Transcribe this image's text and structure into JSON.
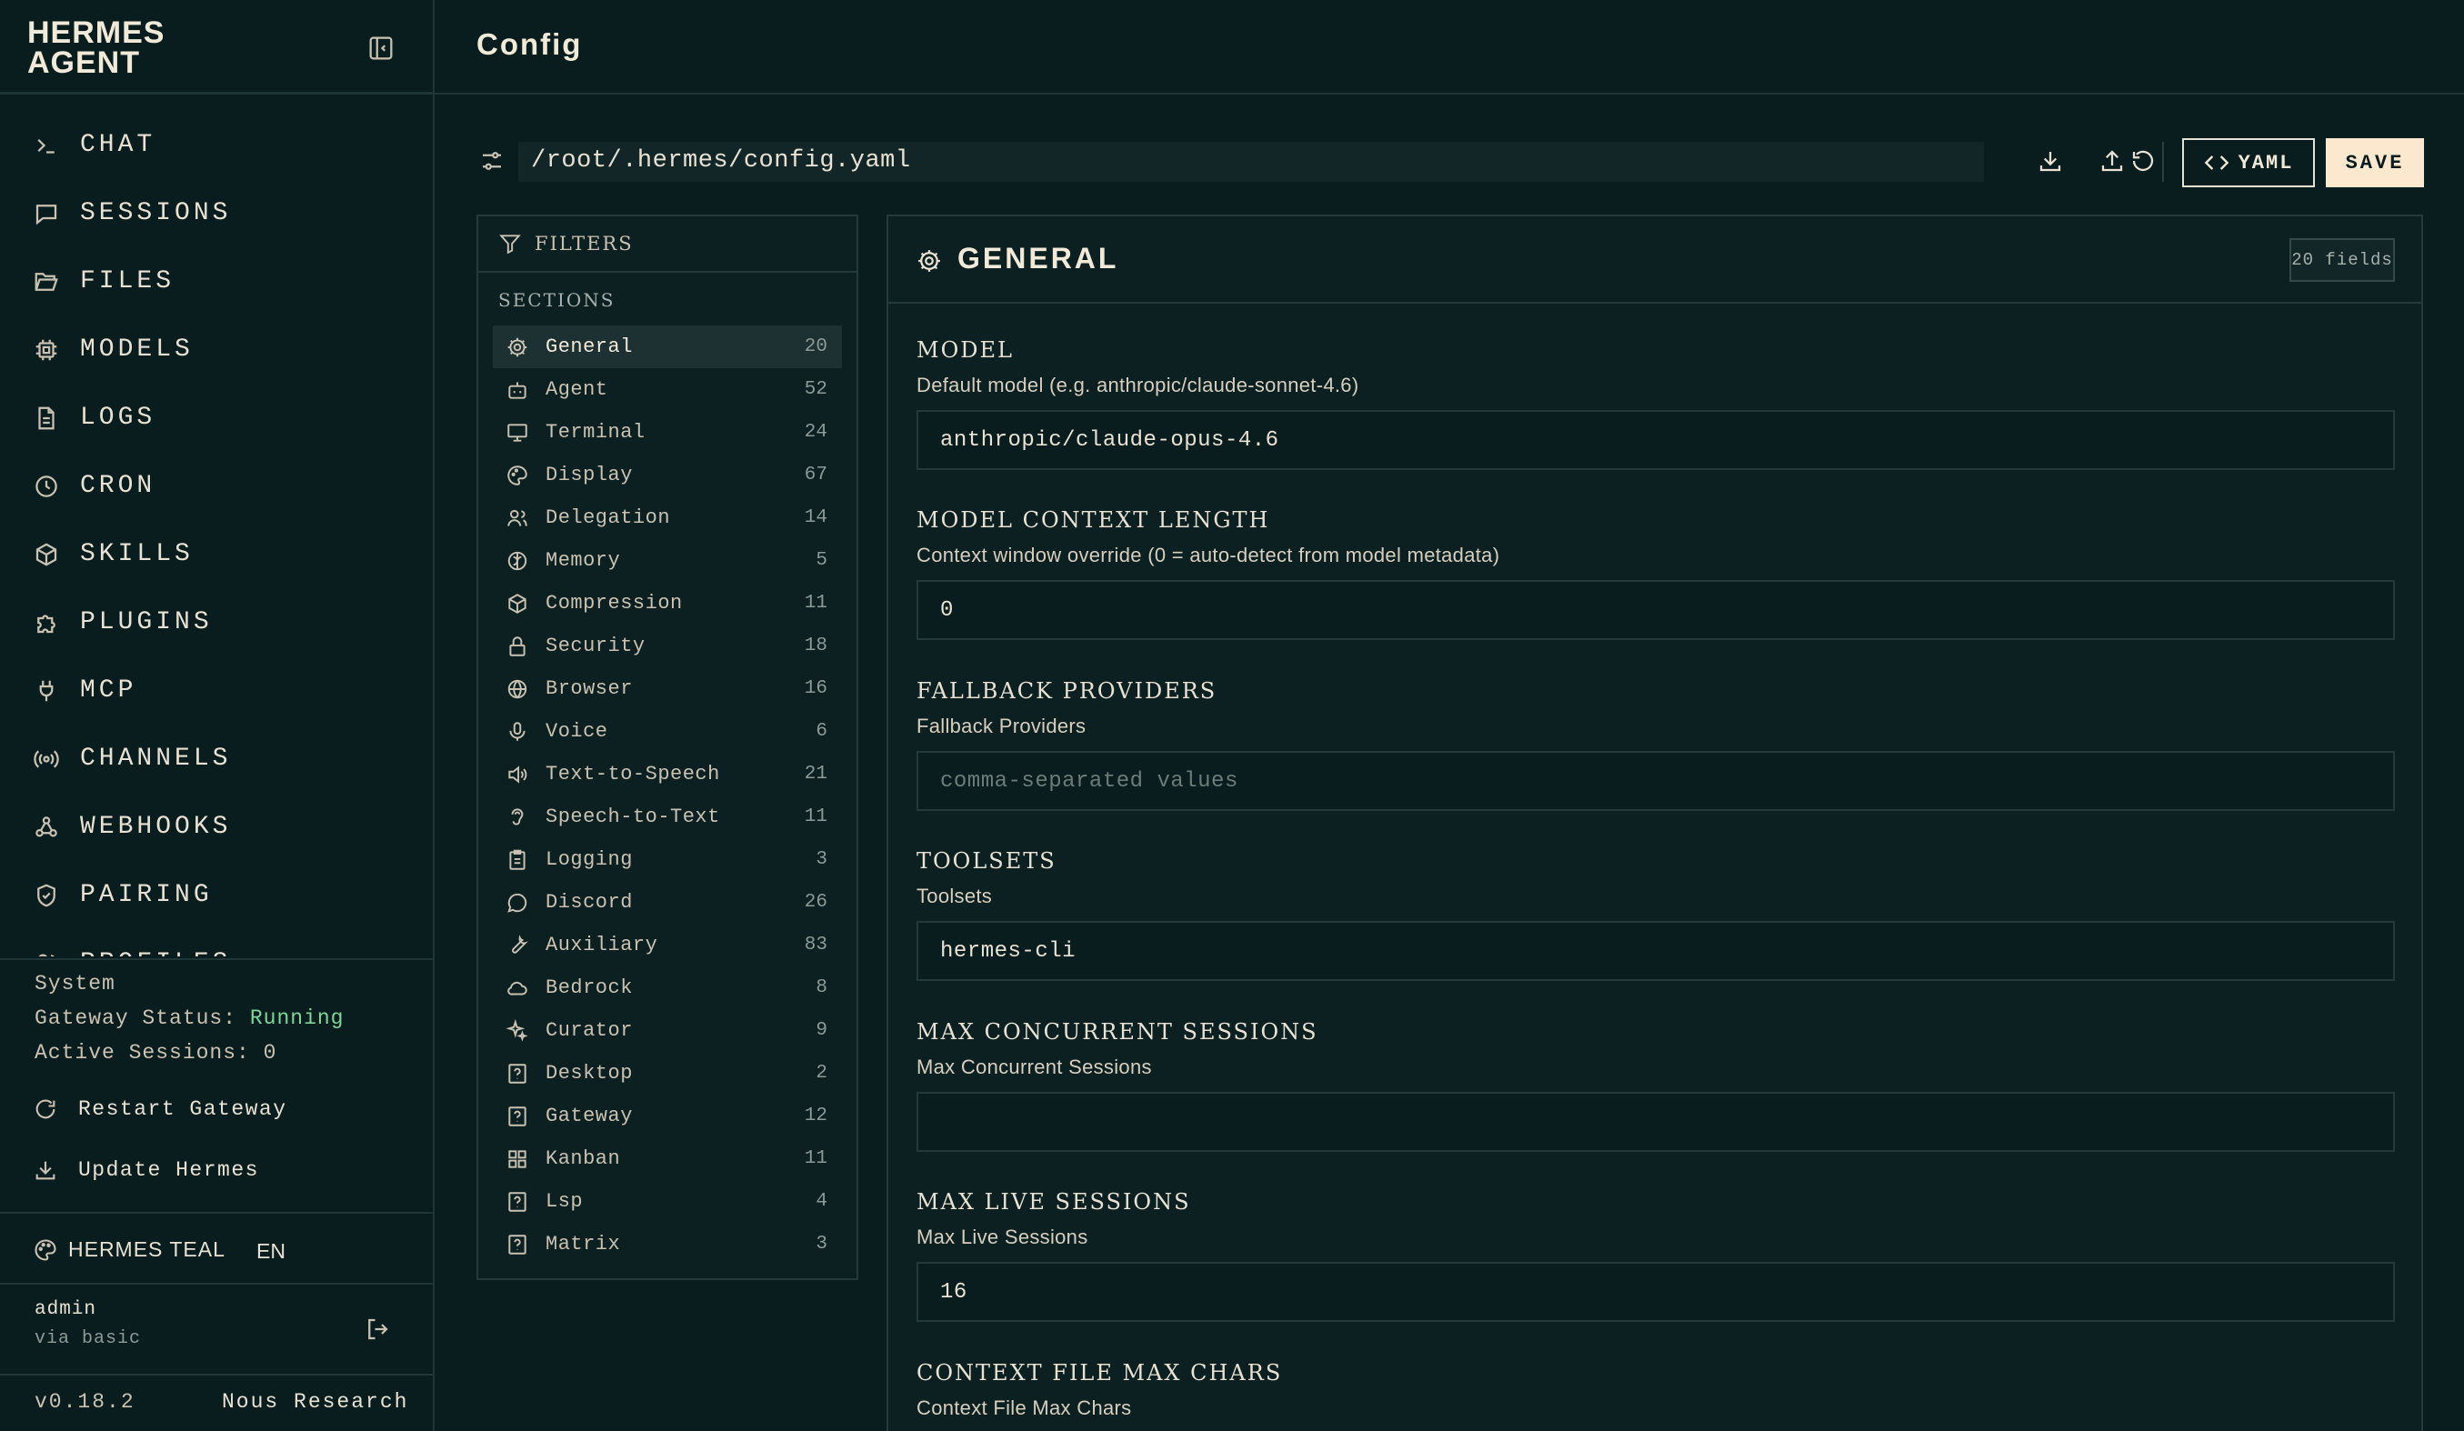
{
  "brand": {
    "line1": "HERMES",
    "line2": "AGENT"
  },
  "nav": [
    {
      "label": "CHAT",
      "icon": "terminal-icon"
    },
    {
      "label": "SESSIONS",
      "icon": "message-square-icon"
    },
    {
      "label": "FILES",
      "icon": "folder-open-icon"
    },
    {
      "label": "MODELS",
      "icon": "cpu-icon"
    },
    {
      "label": "LOGS",
      "icon": "file-text-icon"
    },
    {
      "label": "CRON",
      "icon": "clock-icon"
    },
    {
      "label": "SKILLS",
      "icon": "package-icon"
    },
    {
      "label": "PLUGINS",
      "icon": "puzzle-icon"
    },
    {
      "label": "MCP",
      "icon": "plug-icon"
    },
    {
      "label": "CHANNELS",
      "icon": "radio-icon"
    },
    {
      "label": "WEBHOOKS",
      "icon": "webhook-icon"
    },
    {
      "label": "PAIRING",
      "icon": "shield-check-icon"
    },
    {
      "label": "PROFILES",
      "icon": "users-icon"
    }
  ],
  "system": {
    "heading": "System",
    "gateway_label": "Gateway Status:",
    "gateway_value": "Running",
    "sessions_label": "Active Sessions:",
    "sessions_value": "0",
    "restart_label": "Restart Gateway",
    "update_label": "Update Hermes"
  },
  "theme": {
    "name": "HERMES TEAL",
    "lang": "EN"
  },
  "user": {
    "name": "admin",
    "via": "via basic"
  },
  "footer": {
    "version": "v0.18.2",
    "vendor": "Nous Research"
  },
  "header": {
    "title": "Config"
  },
  "config": {
    "path": "/root/.hermes/config.yaml",
    "yaml_label": "YAML",
    "save_label": "SAVE"
  },
  "filters": {
    "title": "FILTERS",
    "sections_label": "SECTIONS",
    "sections": [
      {
        "name": "General",
        "count": "20",
        "icon": "gear-icon"
      },
      {
        "name": "Agent",
        "count": "52",
        "icon": "bot-icon"
      },
      {
        "name": "Terminal",
        "count": "24",
        "icon": "monitor-icon"
      },
      {
        "name": "Display",
        "count": "67",
        "icon": "palette-icon"
      },
      {
        "name": "Delegation",
        "count": "14",
        "icon": "users-icon"
      },
      {
        "name": "Memory",
        "count": "5",
        "icon": "brain-icon"
      },
      {
        "name": "Compression",
        "count": "11",
        "icon": "package-icon"
      },
      {
        "name": "Security",
        "count": "18",
        "icon": "lock-icon"
      },
      {
        "name": "Browser",
        "count": "16",
        "icon": "globe-icon"
      },
      {
        "name": "Voice",
        "count": "6",
        "icon": "mic-icon"
      },
      {
        "name": "Text-to-Speech",
        "count": "21",
        "icon": "volume-icon"
      },
      {
        "name": "Speech-to-Text",
        "count": "11",
        "icon": "ear-icon"
      },
      {
        "name": "Logging",
        "count": "3",
        "icon": "clipboard-icon"
      },
      {
        "name": "Discord",
        "count": "26",
        "icon": "message-circle-icon"
      },
      {
        "name": "Auxiliary",
        "count": "83",
        "icon": "wrench-icon"
      },
      {
        "name": "Bedrock",
        "count": "8",
        "icon": "cloud-icon"
      },
      {
        "name": "Curator",
        "count": "9",
        "icon": "sparkles-icon"
      },
      {
        "name": "Desktop",
        "count": "2",
        "icon": "help-square-icon"
      },
      {
        "name": "Gateway",
        "count": "12",
        "icon": "help-square-icon"
      },
      {
        "name": "Kanban",
        "count": "11",
        "icon": "grid-icon"
      },
      {
        "name": "Lsp",
        "count": "4",
        "icon": "help-square-icon"
      },
      {
        "name": "Matrix",
        "count": "3",
        "icon": "help-square-icon"
      }
    ]
  },
  "general": {
    "title": "GENERAL",
    "fields_badge": "20 fields",
    "fields": [
      {
        "title": "MODEL",
        "desc": "Default model (e.g. anthropic/claude-sonnet-4.6)",
        "value": "anthropic/claude-opus-4.6",
        "placeholder": ""
      },
      {
        "title": "MODEL CONTEXT LENGTH",
        "desc": "Context window override (0 = auto-detect from model metadata)",
        "value": "0",
        "placeholder": ""
      },
      {
        "title": "FALLBACK PROVIDERS",
        "desc": "Fallback Providers",
        "value": "",
        "placeholder": "comma-separated values"
      },
      {
        "title": "TOOLSETS",
        "desc": "Toolsets",
        "value": "hermes-cli",
        "placeholder": ""
      },
      {
        "title": "MAX CONCURRENT SESSIONS",
        "desc": "Max Concurrent Sessions",
        "value": "",
        "placeholder": ""
      },
      {
        "title": "MAX LIVE SESSIONS",
        "desc": "Max Live Sessions",
        "value": "16",
        "placeholder": ""
      },
      {
        "title": "CONTEXT FILE MAX CHARS",
        "desc": "Context File Max Chars",
        "value": "",
        "placeholder": ""
      }
    ]
  },
  "colors": {
    "background": "#0a1d1e",
    "accent": "#fbe8cf",
    "running": "#7fd69a",
    "text": "#e8e2d4"
  }
}
